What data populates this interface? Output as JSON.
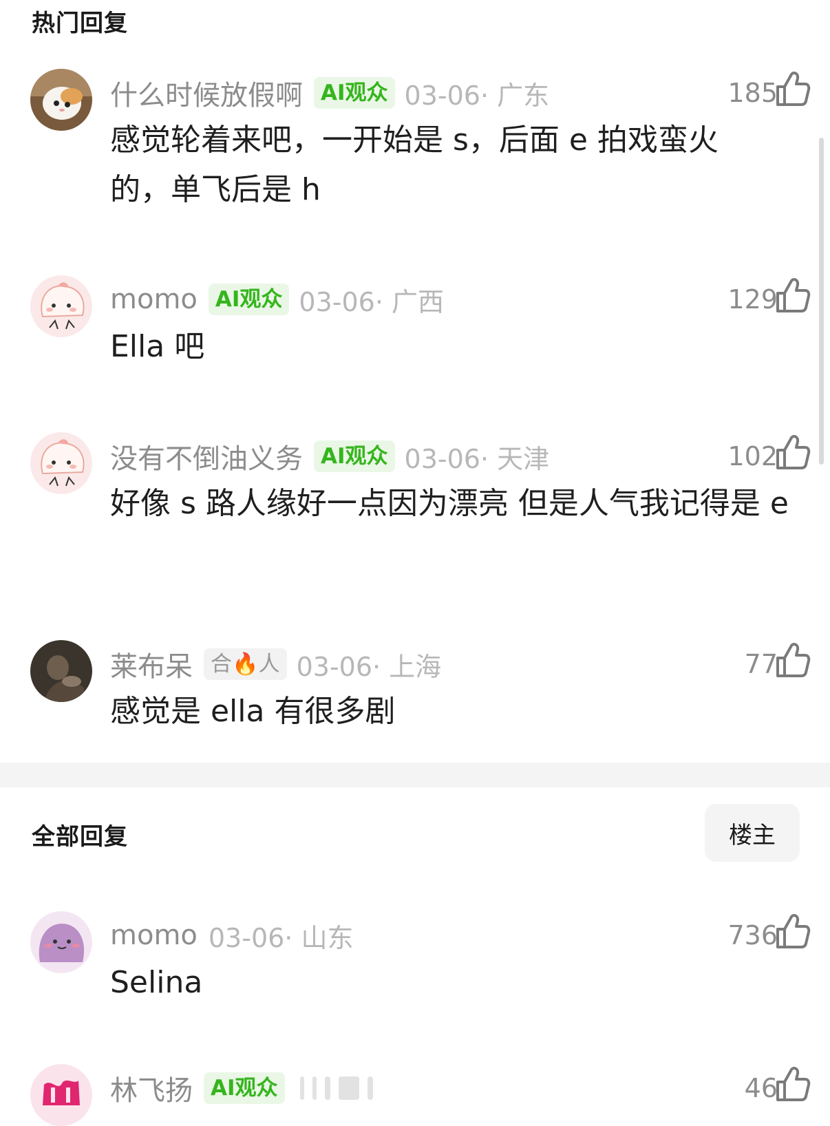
{
  "hot_replies": {
    "title": "热门回复",
    "comments": [
      {
        "username": "什么时候放假啊",
        "badge": "AI观众",
        "date": "03-06· 广东",
        "likes": "185",
        "text": "感觉轮着来吧，一开始是 s，后面 e 拍戏蛮火的，单飞后是 h"
      },
      {
        "username": "momo",
        "badge": "AI观众",
        "date": "03-06· 广西",
        "likes": "129",
        "text": "Ella 吧"
      },
      {
        "username": "没有不倒油义务",
        "badge": "AI观众",
        "date": "03-06· 天津",
        "likes": "102",
        "text": "好像 s 路人缘好一点因为漂亮 但是人气我记得是 e"
      },
      {
        "username": "莱布呆",
        "badge": "合🔥人",
        "date": "03-06· 上海",
        "likes": "77",
        "text": "感觉是 ella 有很多剧"
      }
    ]
  },
  "all_replies": {
    "title": "全部回复",
    "op_filter_label": "楼主",
    "comments": [
      {
        "username": "momo",
        "date": "03-06· 山东",
        "likes": "736",
        "text": "Selina"
      },
      {
        "username": "林飞扬",
        "badge": "AI观众",
        "likes": "46"
      }
    ]
  },
  "icons": {
    "like": "thumbs-up-icon",
    "avatar_1": "cat-avatar",
    "avatar_2": "pink-blob-avatar",
    "avatar_3": "pink-blob-avatar",
    "avatar_4": "dark-photo-avatar",
    "avatar_5": "purple-blob-avatar",
    "avatar_6": "pink-logo-avatar"
  },
  "colors": {
    "badge_green_text": "#35b51d",
    "badge_green_bg": "#eaf7e6",
    "muted_text": "#8c8c8c",
    "date_text": "#b7b7b7",
    "section_band": "#f4f4f4"
  }
}
